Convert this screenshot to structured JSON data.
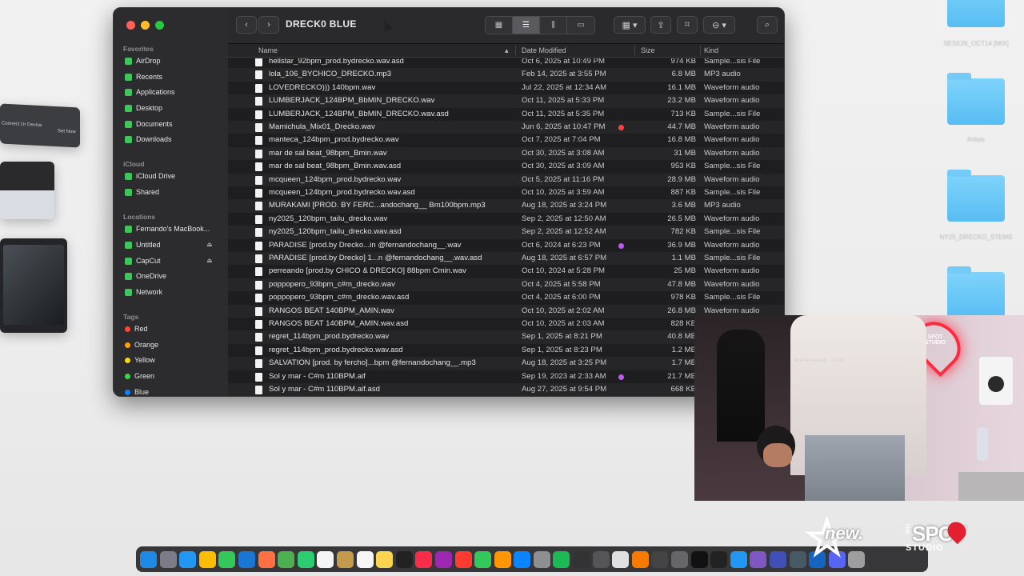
{
  "window": {
    "title": "DRECK0 BLUE"
  },
  "ghost_windows": {
    "connect_label": "Connect Ur Device",
    "set_label": "Set Now"
  },
  "sidebar": {
    "sections": [
      {
        "label": "Favorites"
      },
      {
        "label": "iCloud"
      },
      {
        "label": "Locations"
      },
      {
        "label": "Tags"
      }
    ],
    "favorites": [
      {
        "label": "AirDrop",
        "icon": "airdrop-icon"
      },
      {
        "label": "Recents",
        "icon": "clock-icon"
      },
      {
        "label": "Applications",
        "icon": "applications-icon"
      },
      {
        "label": "Desktop",
        "icon": "desktop-icon"
      },
      {
        "label": "Documents",
        "icon": "document-icon"
      },
      {
        "label": "Downloads",
        "icon": "download-icon"
      }
    ],
    "icloud": [
      {
        "label": "iCloud Drive",
        "icon": "cloud-icon"
      },
      {
        "label": "Shared",
        "icon": "shared-folder-icon"
      }
    ],
    "locations": [
      {
        "label": "Fernando's MacBook...",
        "icon": "laptop-icon"
      },
      {
        "label": "Untitled",
        "icon": "drive-icon"
      },
      {
        "label": "CapCut",
        "icon": "drive-icon"
      },
      {
        "label": "OneDrive",
        "icon": "cloud-icon"
      },
      {
        "label": "Network",
        "icon": "globe-icon"
      }
    ],
    "tags": [
      {
        "label": "Red",
        "color": "#ff453a"
      },
      {
        "label": "Orange",
        "color": "#ff9f0a"
      },
      {
        "label": "Yellow",
        "color": "#ffd60a"
      },
      {
        "label": "Green",
        "color": "#32d74b"
      },
      {
        "label": "Blue",
        "color": "#0a84ff"
      }
    ]
  },
  "columns": {
    "name": "Name",
    "date": "Date Modified",
    "size": "Size",
    "kind": "Kind"
  },
  "files": [
    {
      "name": "hellstar_92bpm_prod.bydrecko.wav.asd",
      "date": "Oct 6, 2025 at 10:49 PM",
      "size": "974 KB",
      "kind": "Sample...sis File",
      "tag": ""
    },
    {
      "name": "lola_106_BYCHICO_DRECKO.mp3",
      "date": "Feb 14, 2025 at 3:55 PM",
      "size": "6.8 MB",
      "kind": "MP3 audio",
      "tag": ""
    },
    {
      "name": "LOVEDRECKO))) 140bpm.wav",
      "date": "Jul 22, 2025 at 12:34 AM",
      "size": "16.1 MB",
      "kind": "Waveform audio",
      "tag": ""
    },
    {
      "name": "LUMBERJACK_124BPM_BbMIN_DRECKO.wav",
      "date": "Oct 11, 2025 at 5:33 PM",
      "size": "23.2 MB",
      "kind": "Waveform audio",
      "tag": ""
    },
    {
      "name": "LUMBERJACK_124BPM_BbMIN_DRECKO.wav.asd",
      "date": "Oct 11, 2025 at 5:35 PM",
      "size": "713 KB",
      "kind": "Sample...sis File",
      "tag": ""
    },
    {
      "name": "Mamichula_Mix01_Drecko.wav",
      "date": "Jun 6, 2025 at 10:47 PM",
      "size": "44.7 MB",
      "kind": "Waveform audio",
      "tag": "#ff453a"
    },
    {
      "name": "manteca_124bpm_prod.bydrecko.wav",
      "date": "Oct 7, 2025 at 7:04 PM",
      "size": "16.8 MB",
      "kind": "Waveform audio",
      "tag": ""
    },
    {
      "name": "mar de sal beat_98bpm_Bmin.wav",
      "date": "Oct 30, 2025 at 3:08 AM",
      "size": "31 MB",
      "kind": "Waveform audio",
      "tag": ""
    },
    {
      "name": "mar de sal beat_98bpm_Bmin.wav.asd",
      "date": "Oct 30, 2025 at 3:09 AM",
      "size": "953 KB",
      "kind": "Sample...sis File",
      "tag": ""
    },
    {
      "name": "mcqueen_124bpm_prod.bydrecko.wav",
      "date": "Oct 5, 2025 at 11:16 PM",
      "size": "28.9 MB",
      "kind": "Waveform audio",
      "tag": ""
    },
    {
      "name": "mcqueen_124bpm_prod.bydrecko.wav.asd",
      "date": "Oct 10, 2025 at 3:59 AM",
      "size": "887 KB",
      "kind": "Sample...sis File",
      "tag": ""
    },
    {
      "name": "MURAKAMI [PROD. BY FERC...andochang__ Bm100bpm.mp3",
      "date": "Aug 18, 2025 at 3:24 PM",
      "size": "3.6 MB",
      "kind": "MP3 audio",
      "tag": ""
    },
    {
      "name": "ny2025_120bpm_tailu_drecko.wav",
      "date": "Sep 2, 2025 at 12:50 AM",
      "size": "26.5 MB",
      "kind": "Waveform audio",
      "tag": ""
    },
    {
      "name": "ny2025_120bpm_tailu_drecko.wav.asd",
      "date": "Sep 2, 2025 at 12:52 AM",
      "size": "782 KB",
      "kind": "Sample...sis File",
      "tag": ""
    },
    {
      "name": "PARADISE [prod.by Drecko...in @fernandochang__.wav",
      "date": "Oct 6, 2024 at 6:23 PM",
      "size": "36.9 MB",
      "kind": "Waveform audio",
      "tag": "#bf5af2"
    },
    {
      "name": "PARADISE [prod.by Drecko] 1...n @fernandochang__.wav.asd",
      "date": "Aug 18, 2025 at 6:57 PM",
      "size": "1.1 MB",
      "kind": "Sample...sis File",
      "tag": ""
    },
    {
      "name": "perreando [prod.by CHICO & DRECKO] 88bpm Cmin.wav",
      "date": "Oct 10, 2024 at 5:28 PM",
      "size": "25 MB",
      "kind": "Waveform audio",
      "tag": ""
    },
    {
      "name": "poppopero_93bpm_c#m_drecko.wav",
      "date": "Oct 4, 2025 at 5:58 PM",
      "size": "47.8 MB",
      "kind": "Waveform audio",
      "tag": ""
    },
    {
      "name": "poppopero_93bpm_c#m_drecko.wav.asd",
      "date": "Oct 4, 2025 at 6:00 PM",
      "size": "978 KB",
      "kind": "Sample...sis File",
      "tag": ""
    },
    {
      "name": "RANGOS BEAT 140BPM_AMIN.wav",
      "date": "Oct 10, 2025 at 2:02 AM",
      "size": "26.8 MB",
      "kind": "Waveform audio",
      "tag": ""
    },
    {
      "name": "RANGOS BEAT 140BPM_AMIN.wav.asd",
      "date": "Oct 10, 2025 at 2:03 AM",
      "size": "828 KB",
      "kind": "Sample...sis File",
      "tag": ""
    },
    {
      "name": "regret_114bpm_prod.bydrecko.wav",
      "date": "Sep 1, 2025 at 8:21 PM",
      "size": "40.8 MB",
      "kind": "Waveform audio",
      "tag": ""
    },
    {
      "name": "regret_114bpm_prod.bydrecko.wav.asd",
      "date": "Sep 1, 2025 at 8:23 PM",
      "size": "1.2 MB",
      "kind": "Sample...sis File",
      "tag": ""
    },
    {
      "name": "SALVATION [prod. by fercho]...bpm @fernandochang__.mp3",
      "date": "Aug 18, 2025 at 3:25 PM",
      "size": "1.7 MB",
      "kind": "MP3 audio",
      "tag": ""
    },
    {
      "name": "Sol y mar - C#m 110BPM.aif",
      "date": "Sep 19, 2023 at 2:33 AM",
      "size": "21.7 MB",
      "kind": "AIFF audio",
      "tag": "#bf5af2"
    },
    {
      "name": "Sol y mar - C#m 110BPM.aif.asd",
      "date": "Aug 27, 2025 at 9:54 PM",
      "size": "668 KB",
      "kind": "Sample...sis File",
      "tag": ""
    }
  ],
  "desktop_folders": [
    {
      "label": "SESION_OCT14 [MIX]"
    },
    {
      "label": "Artists"
    },
    {
      "label": "NY25_DRECKO_STEMS"
    },
    {
      "label": ""
    }
  ],
  "webcam": {
    "neon_sign": "SPOT STUDIO",
    "ticker": "wavsxwave - com"
  },
  "branding": {
    "new_logo": "new.",
    "spot_the": "THE",
    "spot_main": "SPOT",
    "spot_sub": "STUDIO"
  },
  "dock_apps": [
    {
      "icon": "finder-icon",
      "color": "#1e88e5"
    },
    {
      "icon": "launchpad-icon",
      "color": "#7c7c88"
    },
    {
      "icon": "safari-icon",
      "color": "#2196f3"
    },
    {
      "icon": "chrome-icon",
      "color": "#fbbc04"
    },
    {
      "icon": "messages-icon",
      "color": "#34c759"
    },
    {
      "icon": "mail-icon",
      "color": "#1976d2"
    },
    {
      "icon": "photos-icon",
      "color": "#ff7043"
    },
    {
      "icon": "maps-icon",
      "color": "#4caf50"
    },
    {
      "icon": "facetime-icon",
      "color": "#2ecc71"
    },
    {
      "icon": "calendar-icon",
      "color": "#f5f5f5"
    },
    {
      "icon": "notes-folder-icon",
      "color": "#c49a4b"
    },
    {
      "icon": "reminders-icon",
      "color": "#f5f5f5"
    },
    {
      "icon": "notes-icon",
      "color": "#ffd54f"
    },
    {
      "icon": "tv-icon",
      "color": "#222222"
    },
    {
      "icon": "music-icon",
      "color": "#fa2d48"
    },
    {
      "icon": "podcasts-icon",
      "color": "#9c27b0"
    },
    {
      "icon": "news-icon",
      "color": "#ff3b30"
    },
    {
      "icon": "numbers-icon",
      "color": "#34c759"
    },
    {
      "icon": "pages-icon",
      "color": "#ff9500"
    },
    {
      "icon": "app-store-icon",
      "color": "#0a84ff"
    },
    {
      "icon": "settings-icon",
      "color": "#8e8e93"
    },
    {
      "icon": "spotify-icon",
      "color": "#1db954"
    },
    {
      "icon": "waveform-icon",
      "color": "#333333"
    },
    {
      "icon": "utility-icon",
      "color": "#555555"
    },
    {
      "icon": "live-icon",
      "color": "#e0e0e0"
    },
    {
      "icon": "fl-studio-icon",
      "color": "#f57c00"
    },
    {
      "icon": "help-icon",
      "color": "#444444"
    },
    {
      "icon": "plugin-icon",
      "color": "#666666"
    },
    {
      "icon": "capcut-icon",
      "color": "#111111"
    },
    {
      "icon": "c-app-icon",
      "color": "#222222"
    },
    {
      "icon": "loop-icon",
      "color": "#2196f3"
    },
    {
      "icon": "arc-icon",
      "color": "#7e57c2"
    },
    {
      "icon": "world-icon",
      "color": "#3f51b5"
    },
    {
      "icon": "display-icon",
      "color": "#455a64"
    },
    {
      "icon": "transfer-icon",
      "color": "#1565c0"
    },
    {
      "icon": "discord-icon",
      "color": "#5865f2"
    },
    {
      "icon": "trash-icon",
      "color": "#9e9e9e"
    }
  ]
}
